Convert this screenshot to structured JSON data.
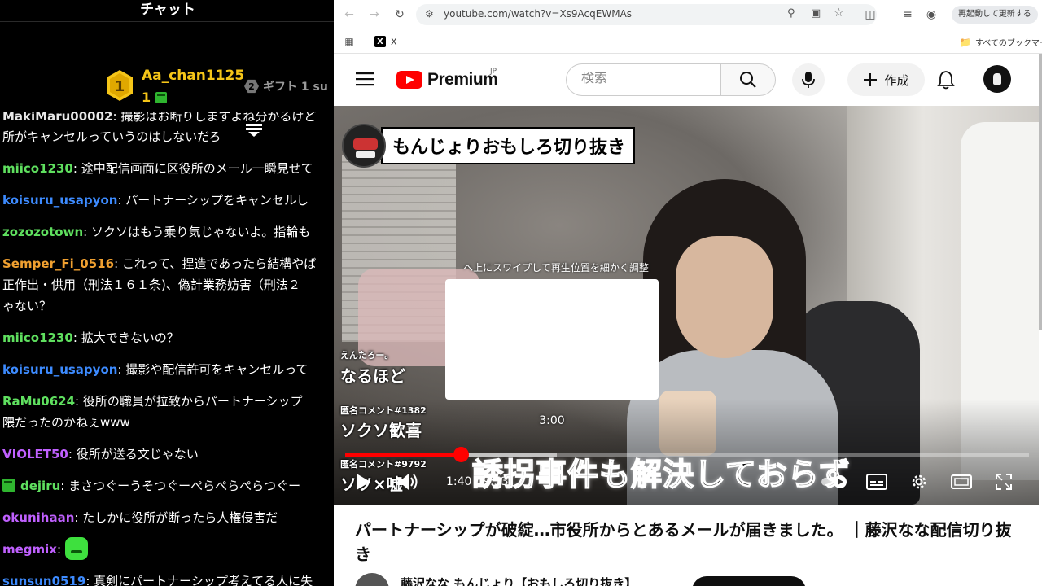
{
  "chat": {
    "title": "チャット",
    "top_user": {
      "rank": "1",
      "name": "Aa_chan1125",
      "count": "1"
    },
    "gift": {
      "rank": "2",
      "label": "ギフト 1 su"
    },
    "messages": [
      {
        "name": "MakiMaru00002",
        "color": "#e8e8e8",
        "text": "撮影はお断りしますよね分かるけど"
      },
      {
        "name": "",
        "color": "#ffffff",
        "text": "所がキャンセルっていうのはしないだろ"
      },
      {
        "name": "miico1230",
        "color": "#5fe05f",
        "text": "途中配信画面に区役所のメール一瞬見せて"
      },
      {
        "name": "koisuru_usapyon",
        "color": "#3d8bff",
        "text": "パートナーシップをキャンセルし"
      },
      {
        "name": "zozozotown",
        "color": "#5fe05f",
        "text": "ソクソはもう乗り気じゃないよ。指輪も"
      },
      {
        "name": "Semper_Fi_0516",
        "color": "#f0a030",
        "text": "これって、捏造であったら結構やば",
        "line2": "正作出・供用（刑法１６１条)、偽計業務妨害（刑法２",
        "line3": "ゃない？"
      },
      {
        "name": "miico1230",
        "color": "#5fe05f",
        "text": "拡大できないの？"
      },
      {
        "name": "koisuru_usapyon",
        "color": "#3d8bff",
        "text": "撮影や配信許可をキャンセルって"
      },
      {
        "name": "RaMu0624",
        "color": "#5fe05f",
        "text": "役所の職員が拉致からパートナーシップ",
        "line2": "隈だったのかねぇwww"
      },
      {
        "name": "VIOLET50",
        "color": "#c060ff",
        "text": "役所が送る文じゃない"
      },
      {
        "name": "dejiru",
        "color": "#5fe05f",
        "text": "まさつぐーうそつぐーぺらぺらぺらつぐー"
      },
      {
        "name": "okunihaan",
        "color": "#c060ff",
        "text": "たしかに役所が断ったら人権侵害だ"
      },
      {
        "name": "megmix",
        "color": "#c060ff",
        "text": ""
      },
      {
        "name": "sunsun0519",
        "color": "#3d8bff",
        "text": "真剣にパートナーシップ考えてる人に失"
      }
    ]
  },
  "browser": {
    "url": "youtube.com/watch?v=Xs9AcqEWMAs",
    "restart_label": "再起動して更新する",
    "bookmark_x": "X",
    "bookmark_all": "すべてのブックマーク"
  },
  "youtube": {
    "logo_text": "Premium",
    "region": "JP",
    "search_placeholder": "検索",
    "create_label": "作成"
  },
  "player": {
    "channel_banner": "もんじょりおもしろ切り抜き",
    "swipe_hint": "へ上にスワイプして再生位置を細かく調整",
    "preview_time": "3:00",
    "anon1_name": "えんたろー。",
    "anon1_text": "なるほど",
    "anon2_name": "匿名コメント#1382",
    "anon2_text": "ソクソ歓喜",
    "anon3_name": "匿名コメント#9792",
    "anon3_text": "ソソ×嘘",
    "subtitle": "誘拐事件も解決しておらず",
    "current_time": "1:40",
    "duration": "9:53",
    "progress_fraction": 0.169,
    "buffer_fraction": 0.31
  },
  "video": {
    "title": "パートナーシップが破綻…市役所からとあるメールが届きました。 ｜藤沢なな配信切り抜き",
    "channel_name": "藤沢なな もんじょり【おもしろ切り抜き】"
  }
}
